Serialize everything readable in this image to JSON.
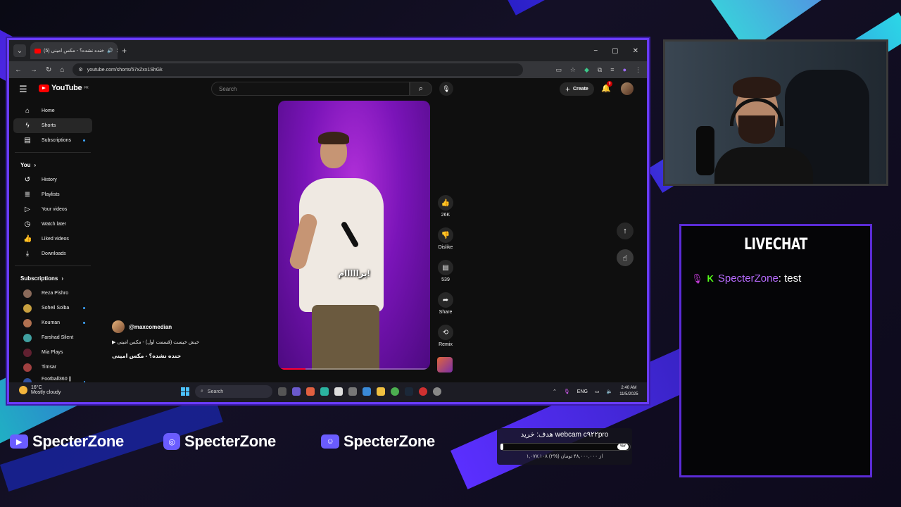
{
  "browser": {
    "tab_title": "(5) خنده نشده؟ - مکس امینی",
    "url": "youtube.com/shorts/57xZxx1ShGk",
    "window_controls": [
      "−",
      "▢",
      "✕"
    ]
  },
  "youtube": {
    "logo": "YouTube",
    "logo_region": "FR",
    "search_placeholder": "Search",
    "create_label": "Create",
    "notif_count": "9",
    "sidebar": {
      "main": [
        {
          "label": "Home",
          "icon": "home-icon"
        },
        {
          "label": "Shorts",
          "icon": "shorts-icon"
        },
        {
          "label": "Subscriptions",
          "icon": "subscriptions-icon"
        }
      ],
      "you_heading": "You",
      "you_items": [
        {
          "label": "History",
          "icon": "history-icon"
        },
        {
          "label": "Playlists",
          "icon": "playlists-icon"
        },
        {
          "label": "Your videos",
          "icon": "your-videos-icon"
        },
        {
          "label": "Watch later",
          "icon": "watch-later-icon"
        },
        {
          "label": "Liked videos",
          "icon": "liked-videos-icon"
        },
        {
          "label": "Downloads",
          "icon": "downloads-icon"
        }
      ],
      "subs_heading": "Subscriptions",
      "subscriptions": [
        {
          "label": "Reza Pishro",
          "color": "#8a6a5a"
        },
        {
          "label": "Soheil Solba",
          "color": "#c8a040"
        },
        {
          "label": "Kouman",
          "color": "#b07050"
        },
        {
          "label": "Farshad Silent",
          "color": "#40a0a0"
        },
        {
          "label": "Mia Plays",
          "color": "#602030"
        },
        {
          "label": "Timsar",
          "color": "#a04040"
        },
        {
          "label": "Football360 || ۳۶۰...",
          "color": "#3050a0"
        }
      ]
    },
    "short": {
      "caption": "پرااااام!",
      "channel": "@maxcomedian",
      "description": "▶ خیش خیست (قسمت اول) - مکس امینی",
      "title": "خنده نشده؟ - مکس امینی",
      "progress": 0.18
    },
    "actions": {
      "likes": "26K",
      "dislike": "Dislike",
      "comments": "539",
      "share": "Share",
      "remix": "Remix"
    }
  },
  "taskbar": {
    "temp": "16°C",
    "weather": "Mostly cloudy",
    "search": "Search",
    "lang": "ENG",
    "time": "2:40 AM",
    "date": "11/5/2025"
  },
  "overlay": {
    "livechat_title": "LIVECHAT",
    "chat_user": "SpecterZone",
    "chat_text": ": test",
    "socials": [
      "SpecterZone",
      "SpecterZone",
      "SpecterZone"
    ],
    "goal_title": "هدف: خرید webcam c۹۲۲pro",
    "goal_pct": "%۲",
    "goal_progress": 0.02,
    "goal_sub": "۱,۰۷۷,۱۰۸ از ۴۸,۰۰۰,۰۰۰ تومان (%۲)"
  }
}
